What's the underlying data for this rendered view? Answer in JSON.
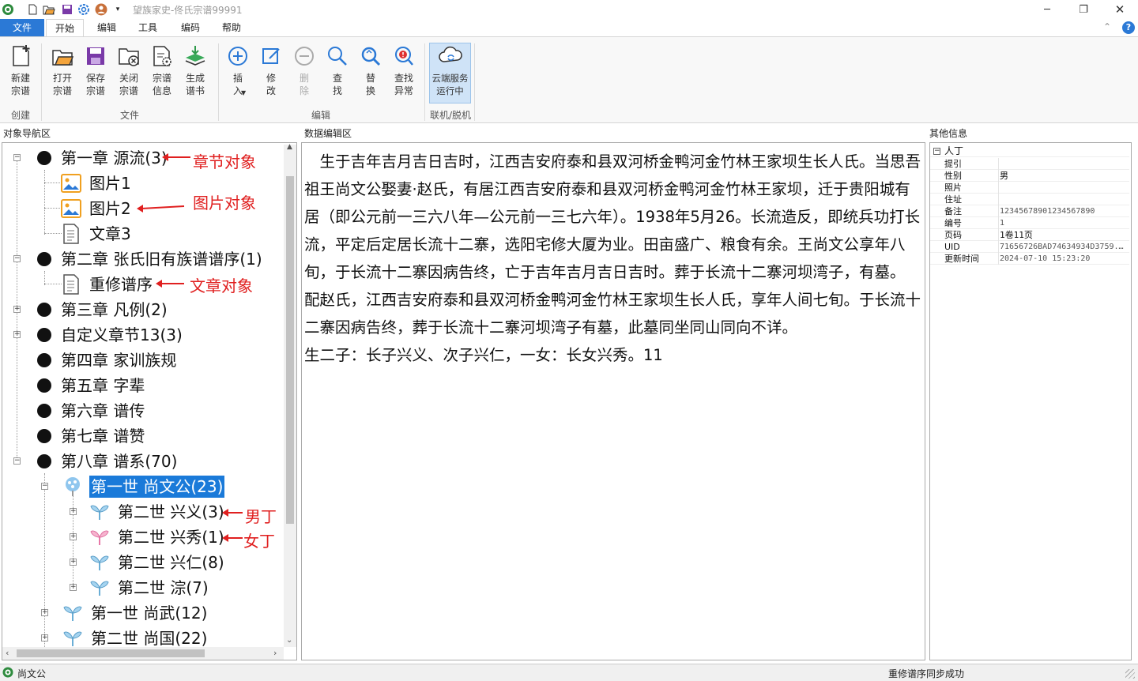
{
  "app": {
    "title": "望族家史-佟氏宗谱99991"
  },
  "menu": {
    "file": "文件",
    "home": "开始",
    "edit": "编辑",
    "tools": "工具",
    "encode": "编码",
    "help": "帮助"
  },
  "ribbon": {
    "buttons": {
      "new": "新建\n宗谱",
      "open": "打开\n宗谱",
      "save": "保存\n宗谱",
      "close": "关闭\n宗谱",
      "info": "宗谱\n信息",
      "gen": "生成\n谱书",
      "insert": "插\n入",
      "modify": "修\n改",
      "delete": "删\n除",
      "find": "查\n找",
      "replace": "替\n换",
      "anomaly": "查找\n异常",
      "cloud": "云端服务\n运行中"
    },
    "groups": {
      "create": "创建",
      "file": "文件",
      "edit": "编辑",
      "online": "联机/脱机"
    }
  },
  "panels": {
    "nav": "对象导航区",
    "editor": "数据编辑区",
    "info": "其他信息"
  },
  "tree": {
    "ch1": "第一章 源流(3)",
    "pic1": "图片1",
    "pic2": "图片2",
    "art3": "文章3",
    "ch2": "第二章 张氏旧有族谱谱序(1)",
    "art_rev": "重修谱序",
    "ch3": "第三章 凡例(2)",
    "custom": "自定义章节13(3)",
    "ch4": "第四章 家训族规",
    "ch5": "第五章 字辈",
    "ch6": "第六章 谱传",
    "ch7": "第七章 谱赞",
    "ch8": "第八章 谱系(70)",
    "g1a": "第一世 尚文公(23)",
    "g2a": "第二世 兴义(3)",
    "g2b": "第二世 兴秀(1)",
    "g2c": "第二世 兴仁(8)",
    "g2d": "第二世 淙(7)",
    "g1b": "第一世 尚武(12)",
    "g2e": "第二世 尚国(22)"
  },
  "annotations": {
    "chapter": "章节对象",
    "picture": "图片对象",
    "article": "文章对象",
    "male": "男丁",
    "female": "女丁"
  },
  "editor": {
    "p1": "　生于吉年吉月吉日吉时，江西吉安府泰和县双河桥金鸭河金竹林王家坝生长人氏。当思吾祖王尚文公娶妻·赵氏，有居江西吉安府泰和县双河桥金鸭河金竹林王家坝，迁于贵阳城有居（即公元前一三六八年—公元前一三七六年）。1938年5月26。长流造反，即统兵功打长流，平定后定居长流十二寨，选阳宅修大厦为业。田亩盛广、粮食有余。王尚文公享年八旬，于长流十二寨因病告终，亡于吉年吉月吉日吉时。葬于长流十二寨河坝湾子，有墓。",
    "p2": "配赵氏，江西吉安府泰和县双河桥金鸭河金竹林王家坝生长人氏，享年人间七旬。于长流十二寨因病告终，葬于长流十二寨河坝湾子有墓，此墓同坐同山同向不详。",
    "p3": "生二子：长子兴义、次子兴仁，一女：长女兴秀。11"
  },
  "info": {
    "category": "人丁",
    "rows": [
      {
        "key": "提引",
        "value": ""
      },
      {
        "key": "性别",
        "value": "男"
      },
      {
        "key": "照片",
        "value": ""
      },
      {
        "key": "住址",
        "value": ""
      },
      {
        "key": "备注",
        "value": "12345678901234567890"
      },
      {
        "key": "编号",
        "value": "1"
      },
      {
        "key": "页码",
        "value": "1卷11页"
      },
      {
        "key": "UID",
        "value": "71656726BAD74634934D3759..."
      },
      {
        "key": "更新时间",
        "value": "2024-07-10 15:23:20"
      }
    ]
  },
  "status": {
    "left": "尚文公",
    "right": "重修谱序同步成功"
  },
  "colors": {
    "accent": "#2b79d6",
    "selection": "#1a7ad9",
    "annotation": "#e02020"
  }
}
